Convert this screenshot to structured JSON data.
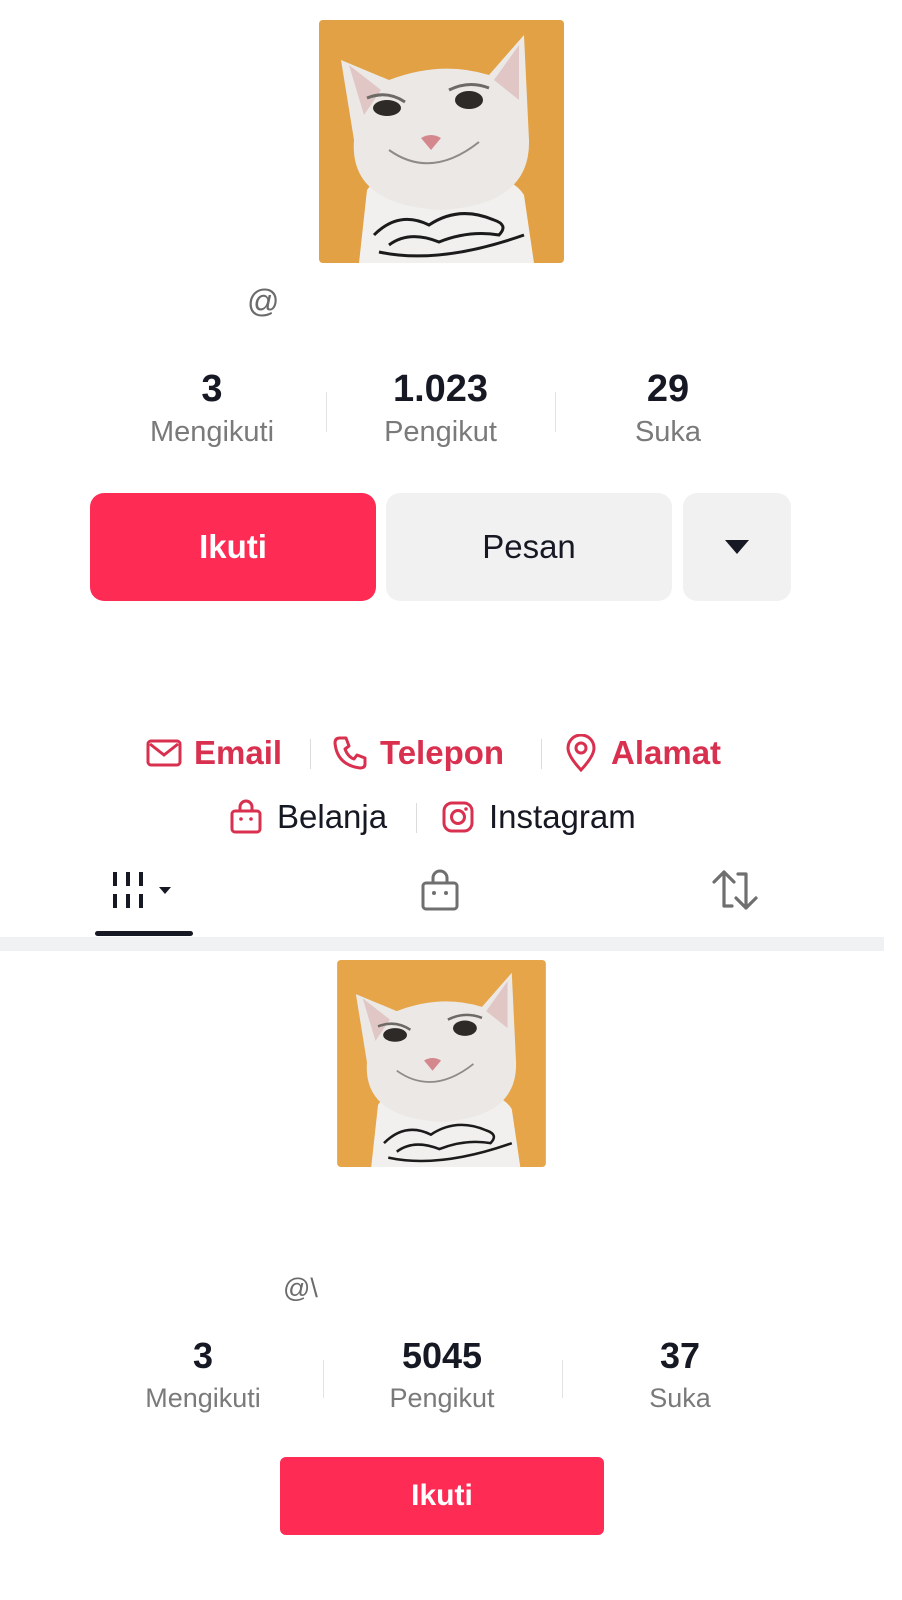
{
  "profile_1": {
    "handle": "@",
    "stats": [
      {
        "value": "3",
        "label": "Mengikuti"
      },
      {
        "value": "1.023",
        "label": "Pengikut"
      },
      {
        "value": "29",
        "label": "Suka"
      }
    ],
    "follow_label": "Ikuti",
    "message_label": "Pesan",
    "more_icon": "caret-down-icon",
    "links": {
      "email": "Email",
      "phone": "Telepon",
      "address": "Alamat",
      "shop": "Belanja",
      "instagram": "Instagram"
    },
    "tabs": [
      {
        "icon": "videos-grid-icon",
        "active": true
      },
      {
        "icon": "shopping-bag-icon",
        "active": false
      },
      {
        "icon": "repost-icon",
        "active": false
      }
    ]
  },
  "profile_2": {
    "handle": "@\\",
    "stats": [
      {
        "value": "3",
        "label": "Mengikuti"
      },
      {
        "value": "5045",
        "label": "Pengikut"
      },
      {
        "value": "37",
        "label": "Suka"
      }
    ],
    "follow_label": "Ikuti"
  },
  "colors": {
    "accent": "#fe2c55",
    "link_accent": "#d9304f",
    "secondary_button": "#f1f1f2",
    "text_primary": "#161823",
    "text_secondary": "#7a7a7a"
  }
}
